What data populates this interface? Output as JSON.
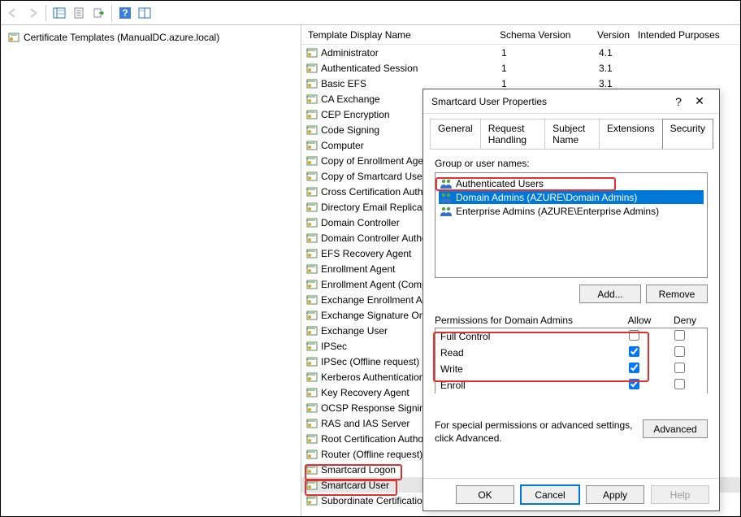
{
  "tree": {
    "root_label": "Certificate Templates (ManualDC.azure.local)"
  },
  "columns": {
    "name": "Template Display Name",
    "schema": "Schema Version",
    "version": "Version",
    "intended": "Intended Purposes"
  },
  "rows": [
    {
      "name": "Administrator",
      "schema": "1",
      "version": "4.1"
    },
    {
      "name": "Authenticated Session",
      "schema": "1",
      "version": "3.1"
    },
    {
      "name": "Basic EFS",
      "schema": "1",
      "version": "3.1"
    },
    {
      "name": "CA Exchange",
      "schema": "",
      "version": ""
    },
    {
      "name": "CEP Encryption",
      "schema": "",
      "version": ""
    },
    {
      "name": "Code Signing",
      "schema": "",
      "version": ""
    },
    {
      "name": "Computer",
      "schema": "",
      "version": ""
    },
    {
      "name": "Copy of Enrollment Agent",
      "schema": "",
      "version": ""
    },
    {
      "name": "Copy of Smartcard User",
      "schema": "",
      "version": ""
    },
    {
      "name": "Cross Certification Authority",
      "schema": "",
      "version": ""
    },
    {
      "name": "Directory Email Replication",
      "schema": "",
      "version": ""
    },
    {
      "name": "Domain Controller",
      "schema": "",
      "version": ""
    },
    {
      "name": "Domain Controller Authentication",
      "schema": "",
      "version": ""
    },
    {
      "name": "EFS Recovery Agent",
      "schema": "",
      "version": ""
    },
    {
      "name": "Enrollment Agent",
      "schema": "",
      "version": ""
    },
    {
      "name": "Enrollment Agent (Computer)",
      "schema": "",
      "version": ""
    },
    {
      "name": "Exchange Enrollment Agent",
      "schema": "",
      "version": ""
    },
    {
      "name": "Exchange Signature Only",
      "schema": "",
      "version": ""
    },
    {
      "name": "Exchange User",
      "schema": "",
      "version": ""
    },
    {
      "name": "IPSec",
      "schema": "",
      "version": ""
    },
    {
      "name": "IPSec (Offline request)",
      "schema": "",
      "version": ""
    },
    {
      "name": "Kerberos Authentication",
      "schema": "",
      "version": ""
    },
    {
      "name": "Key Recovery Agent",
      "schema": "",
      "version": ""
    },
    {
      "name": "OCSP Response Signing",
      "schema": "",
      "version": ""
    },
    {
      "name": "RAS and IAS Server",
      "schema": "",
      "version": ""
    },
    {
      "name": "Root Certification Authority",
      "schema": "",
      "version": ""
    },
    {
      "name": "Router (Offline request)",
      "schema": "",
      "version": ""
    },
    {
      "name": "Smartcard Logon",
      "schema": "",
      "version": ""
    },
    {
      "name": "Smartcard User",
      "schema": "",
      "version": ""
    },
    {
      "name": "Subordinate Certification Authority",
      "schema": "",
      "version": ""
    }
  ],
  "dialog": {
    "title": "Smartcard User Properties",
    "help_glyph": "?",
    "close_glyph": "✕",
    "tabs": [
      "General",
      "Request Handling",
      "Subject Name",
      "Extensions",
      "Security"
    ],
    "active_tab": 4,
    "group_label": "Group or user names:",
    "groups": [
      {
        "label": "Authenticated Users",
        "sel": false
      },
      {
        "label": "Domain Admins (AZURE\\Domain Admins)",
        "sel": true
      },
      {
        "label": "Enterprise Admins (AZURE\\Enterprise Admins)",
        "sel": false
      }
    ],
    "add_label": "Add...",
    "remove_label": "Remove",
    "perm_title": "Permissions for Domain Admins",
    "allow_label": "Allow",
    "deny_label": "Deny",
    "perms": [
      {
        "name": "Full Control",
        "allow": false,
        "deny": false
      },
      {
        "name": "Read",
        "allow": true,
        "deny": false
      },
      {
        "name": "Write",
        "allow": true,
        "deny": false
      },
      {
        "name": "Enroll",
        "allow": true,
        "deny": false
      }
    ],
    "special_text": "For special permissions or advanced settings, click Advanced.",
    "advanced_label": "Advanced",
    "ok": "OK",
    "cancel": "Cancel",
    "apply": "Apply",
    "help": "Help"
  }
}
